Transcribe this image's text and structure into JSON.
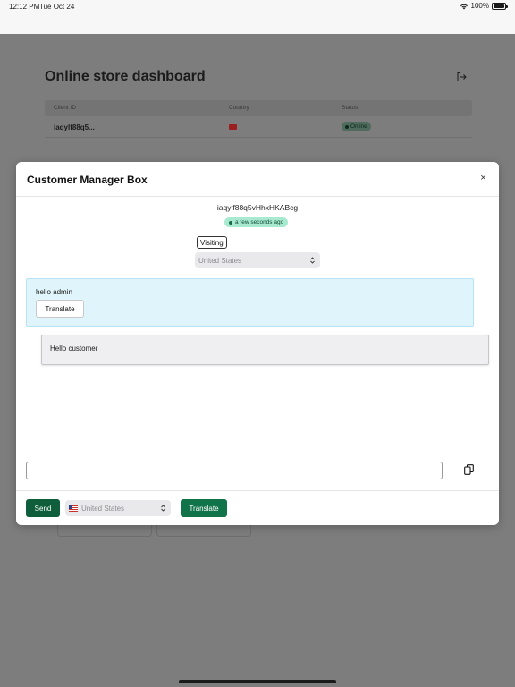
{
  "status_bar": {
    "time": "12:12 PM",
    "date": "Tue Oct 24",
    "battery": "100%"
  },
  "background": {
    "title": "Online store dashboard",
    "table": {
      "headers": [
        "Client ID",
        "Country",
        "Status"
      ],
      "rows": [
        {
          "client_id": "iaqylf88q5...",
          "status": "Online"
        }
      ]
    }
  },
  "modal": {
    "title": "Customer Manager Box",
    "close_label": "×",
    "client_id": "iaqylf88q5vHhxHKABcg",
    "last_seen": "a few seconds ago",
    "visiting_label": "Visiting",
    "country_select": "United States",
    "messages": [
      {
        "from": "customer",
        "text": "hello admin",
        "translate_label": "Translate"
      },
      {
        "from": "admin",
        "text": "Hello customer"
      }
    ],
    "input_value": "",
    "footer": {
      "send_label": "Send",
      "language_select": "United States",
      "translate_label": "Translate"
    }
  },
  "colors": {
    "send_button": "#0e5e3b",
    "translate_button": "#10734a",
    "customer_bubble": "#e0f5fb",
    "admin_bubble": "#efeff1",
    "online_badge": "#a8ead0"
  }
}
